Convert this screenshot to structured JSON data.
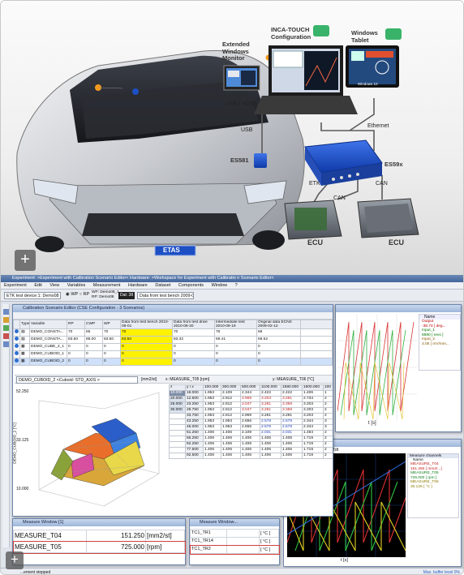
{
  "hero": {
    "labels": {
      "incatouch": "INCA-TOUCH Configuration",
      "tablet": "Windows Tablet",
      "extmon": "Extended Windows Monitor",
      "usbhdmi": "USB / HDMI",
      "usb": "USB",
      "ethernet": "Ethernet",
      "es581": "ES581",
      "es59x": "ES59x",
      "etk": "ETK",
      "can1": "CAN",
      "can2": "CAN",
      "ecu1": "ECU",
      "ecu2": "ECU",
      "win10": "Windows 10",
      "plate": "ETAS"
    },
    "colors": {
      "brand_blue": "#1d4fc4",
      "orange": "#f39a1e",
      "cable": "#5a5a5a"
    }
  },
  "app": {
    "title": "Experiment: >Experiment with Calibration Scenario Editor< Hardware: >Workspace for Experiment with Calibratio n Scenario Editor<",
    "menu": [
      "Experiment",
      "Edit",
      "View",
      "Variables",
      "Measurement",
      "Hardware",
      "Dataset",
      "Components",
      "Window",
      "?"
    ],
    "toolbar": {
      "device": "ETK test device:1: Demo08",
      "wp_label": "WP",
      "rp_label": "RP",
      "wp_value": "WP: Demo08_1",
      "rp_value": "RP: Demo08",
      "badge": "Dat: 38",
      "dataset": "Data from test bench 2009-08"
    },
    "cse": {
      "title": "Calibration Scenario Editor (CSE Configuration - 3 Scenarios)",
      "headers": [
        "Type",
        "Variable",
        "RP",
        "CWP",
        "WP",
        "Data from test bench 2010-08-01",
        "Data from test drive 2010-08-20",
        "Intermediate test 2010-09-19",
        "Original data ECNX 2009-02-12"
      ],
      "rows": [
        [
          "",
          "DEMO_CONSTA...",
          "70",
          "65",
          "70",
          "70",
          "70",
          "76",
          "68"
        ],
        [
          "",
          "DEMO_CONSTA...",
          "83.50",
          "88.00",
          "83.50",
          "83.50",
          "83.32",
          "59.41",
          "69.52"
        ],
        [
          "",
          "DEMO_CUBE_4_1",
          "0",
          "0",
          "0",
          "0",
          "0",
          "0",
          "0"
        ],
        [
          "",
          "DEMO_CUBOID_1",
          "0",
          "0",
          "0",
          "0",
          "0",
          "0",
          "0"
        ],
        [
          "",
          "DEMO_CUBOID_2",
          "0",
          "0",
          "0",
          "0",
          "0",
          "0",
          "0"
        ]
      ],
      "variable_combo": "DEMO_CUBOID_2 <Cuboid: STD_AXIS >",
      "unit": "[mm2/st]",
      "x_axis": "x: MEASURE_T05 [rpm]",
      "y_axis": "y: MEASURE_T06 [°C]",
      "z_label": "z",
      "axis_label": "y \\ x",
      "map_cols": [
        "100.000",
        "300.000",
        "500.000",
        "1100.000",
        "1580.000",
        "1600.000",
        "100"
      ],
      "map_rows": [
        {
          "z": "10.000",
          "y": "18.000",
          "v": [
            "1.953",
            "2.109",
            "2.344",
            "2.422",
            "2.422",
            "1.406",
            "1"
          ]
        },
        {
          "z": "20.000",
          "y": "12.500",
          "v": [
            "1.953",
            "2.812",
            "2.969",
            "3.203",
            "3.281",
            "2.734",
            "2"
          ]
        },
        {
          "z": "25.000",
          "y": "23.250",
          "v": [
            "1.953",
            "2.812",
            "3.047",
            "3.281",
            "3.359",
            "3.203",
            "2"
          ]
        },
        {
          "z": "30.000",
          "y": "28.750",
          "v": [
            "1.953",
            "2.812",
            "3.047",
            "3.281",
            "3.359",
            "3.203",
            "2"
          ]
        },
        {
          "z": "",
          "y": "33.750",
          "v": [
            "1.953",
            "2.812",
            "2.969",
            "3.281",
            "3.281",
            "3.203",
            "2"
          ]
        },
        {
          "z": "",
          "y": "43.250",
          "v": [
            "1.953",
            "1.953",
            "2.656",
            "2.578",
            "2.578",
            "2.344",
            "3"
          ]
        },
        {
          "z": "",
          "y": "45.000",
          "v": [
            "1.953",
            "1.953",
            "2.656",
            "2.578",
            "2.578",
            "2.344",
            "3"
          ]
        },
        {
          "z": "",
          "y": "51.250",
          "v": [
            "1.406",
            "1.406",
            "2.109",
            "2.031",
            "2.031",
            "1.484",
            "2"
          ]
        },
        {
          "z": "",
          "y": "56.250",
          "v": [
            "1.406",
            "1.406",
            "1.406",
            "1.406",
            "1.406",
            "1.719",
            "2"
          ]
        },
        {
          "z": "",
          "y": "62.250",
          "v": [
            "1.406",
            "1.406",
            "1.406",
            "1.406",
            "1.406",
            "1.719",
            "2"
          ]
        },
        {
          "z": "",
          "y": "77.500",
          "v": [
            "1.406",
            "1.406",
            "1.406",
            "1.406",
            "1.406",
            "1.719",
            "2"
          ]
        },
        {
          "z": "",
          "y": "92.500",
          "v": [
            "1.406",
            "1.406",
            "1.406",
            "1.406",
            "1.406",
            "1.719",
            "2"
          ]
        }
      ],
      "plot_z_ticks": [
        "52.250",
        "33.125",
        "10.000"
      ],
      "plot_z_label": "DEMO_CUBOID_2 [°C]"
    },
    "right_plot": {
      "legend_title": "Name",
      "signals": [
        {
          "name": "Output",
          "value": "-38.73 [ deg..."
        },
        {
          "name": "Input_1",
          "value": "8980 [ revs ]"
        },
        {
          "name": "Input_2",
          "value": "3.05 [ mV/mm..."
        }
      ],
      "xlabel": "t [s]"
    },
    "osc": {
      "title": "Tdt",
      "legend_title": "Measure channels",
      "name_col": "Name",
      "channels": [
        {
          "name": "MEASURE_T04",
          "value": "151.250 [ mm2/...]",
          "color": "#e03030"
        },
        {
          "name": "MEASURE_T05",
          "value": "725.000 [ rpm ]",
          "color": "#30c040"
        },
        {
          "name": "MEASURE_T06",
          "value": "30.125 [ °C ]",
          "color": "#e0d020"
        }
      ],
      "xlabel": "t [s]",
      "buffer": "Max. buffer level 0%"
    },
    "measure": {
      "title": "Measure Window [1]",
      "rows": [
        {
          "name": "MEASURE_T04",
          "value": "151.250",
          "unit": "[mm2/st]"
        },
        {
          "name": "MEASURE_T05",
          "value": "725.000",
          "unit": "[rpm]"
        }
      ]
    },
    "measure2": {
      "title": "Measure Window...",
      "rows": [
        {
          "name": "TC1_TR1",
          "unit": "[ °C ]"
        },
        {
          "name": "TC1_TR14",
          "unit": "[ °C ]"
        },
        {
          "name": "TC1_TR2",
          "unit": "[ °C ]"
        }
      ]
    },
    "status": "...ement stopped"
  }
}
